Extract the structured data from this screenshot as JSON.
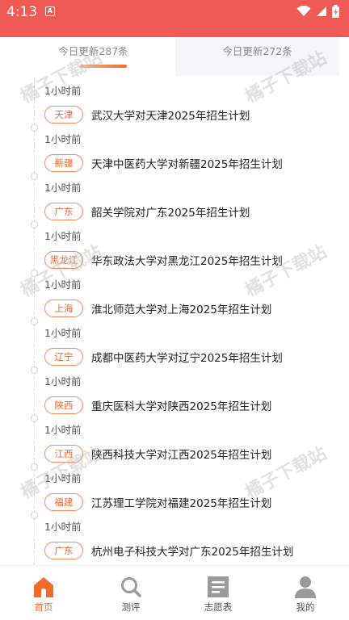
{
  "status_bar": {
    "time": "4:13",
    "notification_letter": "A"
  },
  "tabs": [
    {
      "label": "今日更新287条"
    },
    {
      "label": "今日更新272条"
    }
  ],
  "entries": [
    {
      "time": "1小时前",
      "region": "天津",
      "title": "武汉大学对天津2025年招生计划"
    },
    {
      "time": "1小时前",
      "region": "新疆",
      "title": "天津中医药大学对新疆2025年招生计划"
    },
    {
      "time": "1小时前",
      "region": "广东",
      "title": "韶关学院对广东2025年招生计划"
    },
    {
      "time": "1小时前",
      "region": "黑龙江",
      "title": "华东政法大学对黑龙江2025年招生计划"
    },
    {
      "time": "1小时前",
      "region": "上海",
      "title": "淮北师范大学对上海2025年招生计划"
    },
    {
      "time": "1小时前",
      "region": "辽宁",
      "title": "成都中医药大学对辽宁2025年招生计划"
    },
    {
      "time": "1小时前",
      "region": "陕西",
      "title": "重庆医科大学对陕西2025年招生计划"
    },
    {
      "time": "1小时前",
      "region": "江西",
      "title": "陕西科技大学对江西2025年招生计划"
    },
    {
      "time": "1小时前",
      "region": "福建",
      "title": "江苏理工学院对福建2025年招生计划"
    },
    {
      "time": "1小时前",
      "region": "广东",
      "title": "杭州电子科技大学对广东2025年招生计划"
    }
  ],
  "watermark": {
    "text": "橘子下载站"
  },
  "bottom_nav": [
    {
      "label": "首页",
      "icon": "home-icon",
      "active": true
    },
    {
      "label": "测评",
      "icon": "search-icon",
      "active": false
    },
    {
      "label": "志愿表",
      "icon": "document-icon",
      "active": false
    },
    {
      "label": "我的",
      "icon": "person-icon",
      "active": false
    }
  ],
  "colors": {
    "status_bar": "#f05a55",
    "accent": "#f26b2a",
    "tag_border": "#f08b62",
    "inactive_icon": "#9a9a9a"
  }
}
